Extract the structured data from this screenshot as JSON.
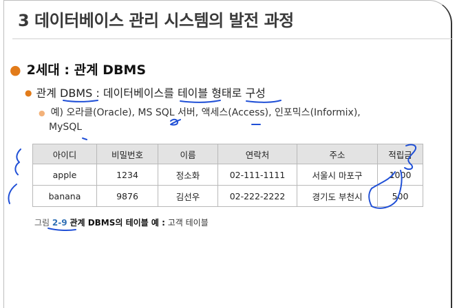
{
  "slide": {
    "title": "3 데이터베이스 관리 시스템의 발전 과정",
    "bullet1": "2세대 : 관계 DBMS",
    "bullet2": "관계 DBMS : 데이터베이스를 테이블 형태로 구성",
    "bullet3_line1": "예) 오라클(Oracle), MS SQL 서버, 액세스(Access), 인포믹스(Informix),",
    "bullet3_line2": "MySQL"
  },
  "table": {
    "headers": [
      "아이디",
      "비밀번호",
      "이름",
      "연락처",
      "주소",
      "적립금"
    ],
    "rows": [
      [
        "apple",
        "1234",
        "정소화",
        "02-111-1111",
        "서울시 마포구",
        "1000"
      ],
      [
        "banana",
        "9876",
        "김선우",
        "02-222-2222",
        "경기도 부천시",
        "500"
      ]
    ]
  },
  "caption": {
    "label": "그림",
    "number": "2-9",
    "bold": "관계 DBMS의 테이블 예 :",
    "rest": "고객 테이블"
  },
  "colors": {
    "bullet_orange": "#e27b1a",
    "ink_blue": "#1f4fd6",
    "table_header_bg": "#e3e3e3"
  }
}
